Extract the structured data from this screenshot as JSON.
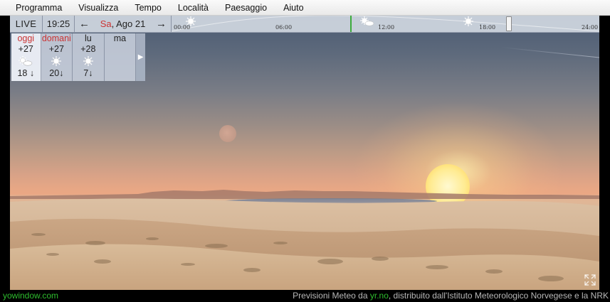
{
  "menu": [
    "Programma",
    "Visualizza",
    "Tempo",
    "Località",
    "Paesaggio",
    "Aiuto"
  ],
  "toolbar": {
    "live_label": "LIVE",
    "time": "19:25",
    "prev_arrow": "←",
    "next_arrow": "→",
    "date_day": "Sa",
    "date_rest": ", Ago 21"
  },
  "timeline": {
    "ticks": [
      "00:00",
      "06:00",
      "12:00",
      "18:00",
      "24:00"
    ],
    "icons": [
      "sun-icon",
      "partly-cloudy-icon",
      "sun-icon"
    ]
  },
  "forecast": {
    "days": [
      {
        "name": "oggi",
        "hi": "+27",
        "icon": "partly-cloudy-icon",
        "lo": "18"
      },
      {
        "name": "domani",
        "hi": "+27",
        "icon": "sun-icon",
        "lo": "20"
      },
      {
        "name": "lu",
        "hi": "+28",
        "icon": "sun-icon",
        "lo": "7"
      },
      {
        "name": "ma",
        "hi": "",
        "icon": "",
        "lo": ""
      }
    ],
    "next_label": "▶"
  },
  "footer": {
    "brand": "yowindow.com",
    "credit_prefix": "Previsioni Meteo da ",
    "credit_link": "yr.no",
    "credit_suffix": ", distribuito dall'Istituto Meteorologico Norvegese e la NRK"
  },
  "colors": {
    "accent_red": "#cc3333",
    "accent_green": "#2ebd2e"
  }
}
